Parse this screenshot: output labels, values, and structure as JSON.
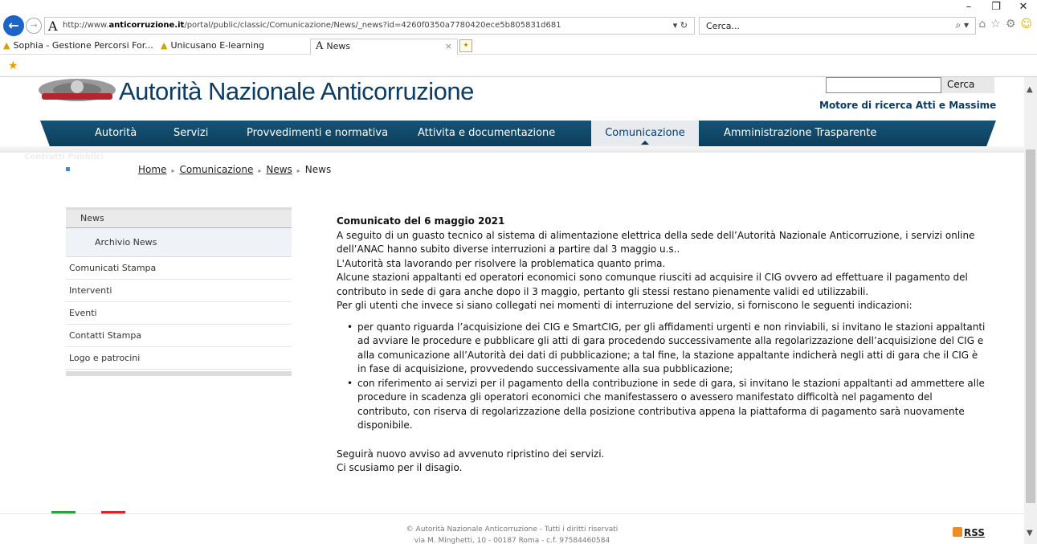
{
  "browser": {
    "window_controls": [
      "–",
      "❐",
      "✕"
    ],
    "address_favicon": "A",
    "url_prefix": "http://www.",
    "url_domain": "anticorruzione.it",
    "url_rest": "/portal/public/classic/Comunicazione/News/_news?id=4260f0350a7780420ece5b805831d681",
    "address_tools": "▾ ↻",
    "search_placeholder": "Cerca...",
    "tabs": [
      {
        "label": "Sophia - Gestione Percorsi For..."
      },
      {
        "label": "Unicusano E-learning"
      },
      {
        "label": "News"
      }
    ],
    "tab_close": "×"
  },
  "site": {
    "title": "Autorità Nazionale Anticorruzione",
    "search_button": "Cerca",
    "search_caption": "Motore di ricerca Atti e Massime",
    "contratti": "Contratti Pubblici",
    "nav": [
      {
        "label": "Autorità"
      },
      {
        "label": "Servizi"
      },
      {
        "label": "Provvedimenti e normativa"
      },
      {
        "label": "Attivita e documentazione"
      },
      {
        "label": "Comunicazione"
      },
      {
        "label": "Amministrazione Trasparente"
      }
    ]
  },
  "breadcrumb": {
    "home": "Home",
    "comunicazione": "Comunicazione",
    "news_link": "News",
    "current": "News",
    "sep": "▸"
  },
  "sidebar": {
    "header": "News",
    "sub_item": "Archivio News",
    "items": [
      {
        "label": "Comunicati Stampa"
      },
      {
        "label": "Interventi"
      },
      {
        "label": "Eventi"
      },
      {
        "label": "Contatti Stampa"
      },
      {
        "label": "Logo e patrocini"
      }
    ]
  },
  "article": {
    "title": "Comunicato del 6 maggio 2021",
    "p1": "A seguito di un guasto tecnico al sistema di alimentazione elettrica della sede dell’Autorità Nazionale Anticorruzione, i servizi online dell’ANAC hanno subito diverse interruzioni a partire dal 3 maggio u.s..",
    "p2": "L'Autorità sta lavorando per risolvere la problematica quanto prima.",
    "p3": "Alcune stazioni appaltanti ed operatori economici sono comunque riusciti ad acquisire il CIG ovvero ad effettuare il pagamento del contributo in sede di gara anche dopo il 3 maggio, pertanto gli stessi restano pienamente validi ed utilizzabili.",
    "p4": "Per gli utenti che invece si siano collegati nei momenti di interruzione del servizio, si forniscono le seguenti indicazioni:",
    "bullets": [
      "per quanto riguarda l’acquisizione dei CIG e SmartCIG, per gli affidamenti urgenti e non rinviabili, si invitano le stazioni appaltanti ad avviare le procedure e pubblicare gli atti di gara procedendo successivamente alla regolarizzazione dell’acquisizione del CIG e alla comunicazione all’Autorità dei dati di pubblicazione; a tal fine, la stazione appaltante indicherà negli atti di gara che il CIG è in fase di acquisizione, provvedendo successivamente alla sua pubblicazione;",
      "con riferimento ai servizi per il pagamento della contribuzione in sede di gara, si invitano le stazioni appaltanti ad ammettere alle procedure in scadenza gli operatori economici che manifestassero o avessero manifestato difficoltà nel pagamento del contributo, con riserva di regolarizzazione della posizione contributiva appena la piattaforma di pagamento sarà nuovamente disponibile."
    ],
    "p5": "Seguirà nuovo avviso ad avvenuto ripristino dei servizi.",
    "p6": "Ci scusiamo per il disagio."
  },
  "footer": {
    "line1": "© Autorità Nazionale Anticorruzione - Tutti i diritti riservati",
    "line2": "via M. Minghetti, 10 - 00187 Roma - c.f. 97584460584",
    "rss": "RSS"
  },
  "colors": {
    "brand_navy": "#0b3c66",
    "nav_blue": "#165477",
    "flag_green": "#2ea03c",
    "flag_red": "#d8232a"
  }
}
